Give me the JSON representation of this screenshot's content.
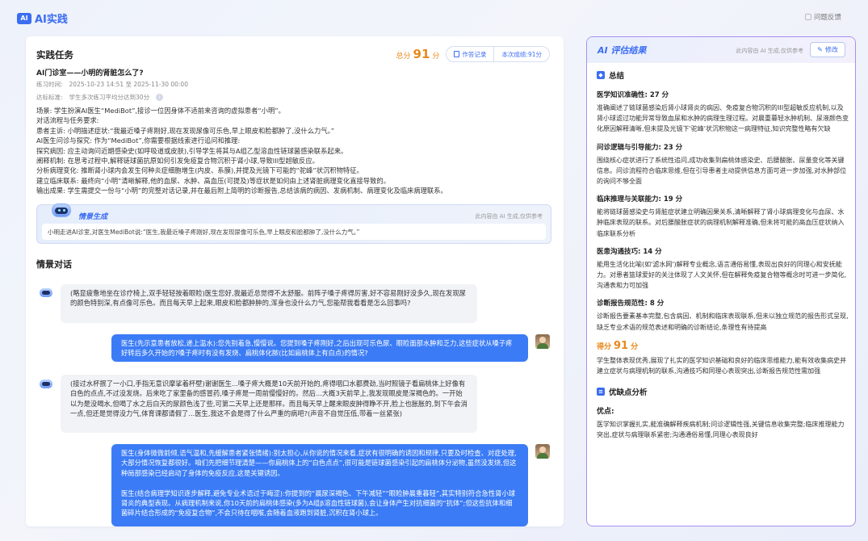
{
  "app": {
    "logo_badge": "AI",
    "title": "AI实践",
    "feedback": "问题反馈"
  },
  "task": {
    "section_title": "实践任务",
    "total_label": "总分",
    "total_score": "91",
    "total_unit": "分",
    "records_button": "作答记录",
    "current_score": "本次成绩:91分",
    "case_name": "AI门诊室——小明的肾脏怎么了?",
    "time_label": "练习时间:",
    "time_value": "2025-10-23 14:51 至 2025-11-30 00:00",
    "standard_label": "达标标准:",
    "standard_value": "学生多次练习平均分达到30分",
    "content": [
      "场景:  学生扮演AI医生“MediBot”,接诊一位因身体不适前来咨询的虚拟患者“小明”。",
      "对话流程与任务要求:",
      "患者主诉:  小明描述症状:“我最近嗓子疼刚好,现在发现尿像可乐色,早上眼皮和脸都肿了,没什么力气。”",
      "AI医生问诊与探究:  作为“MediBot”,你需要根据线索进行追问和推理:",
      "探究病因:  应主动询问近期感染史(如呼吸道或皮肤),引导学生将其与A组乙型溶血性链球菌感染联系起来。",
      "阐释机制:  在思考过程中,解释链球菌抗原如何引发免疫复合物沉积于肾小球,导致III型超敏反应。",
      "分析病理变化:  推断肾小球内会发生何种炎症细胞增生(内皮、系膜),并提及光镜下可能的“驼峰”状沉积物特征。",
      "建立临床联系:  最终向“小明”清晰解释,他的血尿、水肿、高血压(可提及)等症状是如何由上述肾脏病理变化直接导致的。",
      "输出成果:  学生需提交一份与“小明”的完整对话记录,并在最后附上简明的诊断报告,总结该病的病因、发病机制、病理变化及临床病理联系。"
    ]
  },
  "scenario": {
    "title": "情景生成",
    "note": "此内容由 AI 生成,仅供参考",
    "body": "小明走进AI诊室,对医生MediBot说:“医生,我最近嗓子疼刚好,现在发现尿像可乐色,早上眼皮和脸都肿了,没什么力气。”"
  },
  "dialog": {
    "title": "情景对话",
    "messages": [
      {
        "role": "bot",
        "text": "(略显疲惫地坐在诊疗椅上,双手轻轻按着眼睑)医生您好,我最近总觉得不太舒服。前阵子嗓子疼得厉害,好不容易刚好没多久,现在发现尿的颜色特别深,有点像可乐色。而且每天早上起来,眼皮和脸都肿肿的,浑身也没什么力气,您能帮我看看是怎么回事吗?"
      },
      {
        "role": "user",
        "text": "医生(先示意患者放松,递上温水):您先别着急,慢慢说。您提到嗓子疼刚好,之后出现可乐色尿、眼睑面部水肿和乏力,这些症状从嗓子疼好转后多久开始的?嗓子疼时有没有发烧、扁桃体化脓(比如扁桃体上有白点)的情况?"
      },
      {
        "role": "bot",
        "text": "(接过水杯抿了一小口,手指无意识摩挲着杯壁)谢谢医生...嗓子疼大概是10天前开始的,疼得咽口水都费劲,当时照镜子看扁桃体上好像有白色的点点,不过没发烧。后来吃了家里备的感冒药,嗓子疼是一周前慢慢好的。然后...大概3天前早上,我发现眼皮是深褐色的。一开始以为是没喝水,但喝了水之后白天的尿颜色浅了些,可第二天早上还是那样。而且每天早上醒来眼皮肿得睁不开,脸上也胀胀的,到下午会消一点,但还是觉得没力气,体育课都请假了...医生,我这不会是得了什么严重的病吧?(声音不自觉压低,带着一丝紧张)"
      },
      {
        "role": "user",
        "text": "医生(身体微微前倾,语气温和,先缓解患者紧张情绪):别太担心,从你说的情况来看,症状有很明确的诱因和规律,只要及时检查、对症处理,大部分情况恢复都很好。咱们先把细节理清楚——你扁桃体上的“白色点点”,很可能是链球菌感染引起的扁桃体分泌物,虽然没发烧,但这种局部感染已经启动了身体的免疫反应,这是关键诱因。\n\n医生(结合病理学知识逐步解释,避免专业术语过于晦涩):你提到的“晨尿深褐色、下午减轻”“眼睑肿晨重暮轻”,其实特别符合急性肾小球肾炎的典型表现。从病理机制来说,你10天前的扁桃体感染(多为A组β溶血性链球菌),会让身体产生对抗细菌的“抗体”;但这些抗体和细菌碎片结合形成的“免疫复合物”,不会只待在咽喉,会随着血液跑到肾脏,沉积在肾小球上。"
      }
    ]
  },
  "evaluation": {
    "title": "AI 评估结果",
    "note": "此内容由 AI 生成,仅供参考",
    "edit_button": "修改",
    "summary_title": "总结",
    "criteria": [
      {
        "title": "医学知识准确性:  27 分",
        "text": "准确阐述了链球菌感染后肾小球肾炎的病因、免疫复合物沉积的III型超敏反应机制,以及肾小球滤过功能异常导致血尿和水肿的病理生理过程。对晨重暮轻水肿机制、尿液颜色变化原因解释清晰,但未提及光镜下'驼峰'状沉积物这一病理特征,知识完整性略有欠缺"
      },
      {
        "title": "问诊逻辑与引导能力:  23 分",
        "text": "围绕核心症状进行了系统性追问,成功收集到扁桃体感染史、后腰酸胀、尿量变化等关键信息。问诊流程符合临床思维,但在引导患者主动提供信息方面可进一步加强,对水肿部位的询问不够全面"
      },
      {
        "title": "临床推理与关联能力:  19 分",
        "text": "能将链球菌感染史与肾脏症状建立明确因果关系,清晰解释了肾小球病理变化与血尿、水肿临床表现的联系。对后腰酸胀症状的病理机制解释准确,但未将可能的高血压症状纳入临床联系分析"
      },
      {
        "title": "医患沟通技巧:  14 分",
        "text": "能用生活化比喻(如'滤水网')解释专业概念,语言通俗易懂,表现出良好的同理心和安抚能力。对患者篮球爱好的关注体现了人文关怀,但在解释免疫复合物等概念时可进一步简化,沟通表和力可加强"
      },
      {
        "title": "诊断报告规范性:  8 分",
        "text": "诊断报告要素基本完整,包含病因、机制和临床表现联系,但未以独立规范的报告形式呈现,缺乏专业术语的规范表述和明确的诊断结论,条理性有待提高"
      }
    ],
    "final_label": "得分",
    "final_score": "91",
    "final_unit": "分",
    "final_text": "学生整体表现优秀,展现了扎实的医学知识基础和良好的临床思维能力,能有效收集病史并建立症状与病理机制的联系,沟通技巧和同理心表现突出,诊断报告规范性需加强",
    "pros_cons_title": "优缺点分析",
    "pros_label": "优点:",
    "pros_text": "医学知识掌握扎实,能准确解释疾病机制;问诊逻辑性强,关键信息收集完整;临床推理能力突出,症状与病理联系紧密;沟通通俗易懂,同理心表现良好"
  }
}
